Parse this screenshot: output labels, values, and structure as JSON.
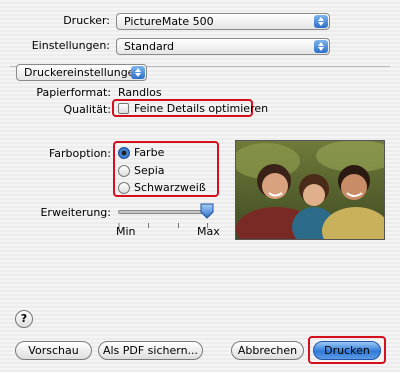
{
  "printer": {
    "label": "Drucker:",
    "value": "PictureMate 500"
  },
  "presets": {
    "label": "Einstellungen:",
    "value": "Standard"
  },
  "panel": {
    "value": "Druckereinstellungen"
  },
  "paper": {
    "label": "Papierformat:",
    "value": "Randlos"
  },
  "quality": {
    "label": "Qualität:",
    "checkbox_label": "Feine Details optimieren",
    "checked": false
  },
  "color_option": {
    "label": "Farboption:",
    "options": [
      {
        "label": "Farbe",
        "selected": true
      },
      {
        "label": "Sepia",
        "selected": false
      },
      {
        "label": "Schwarzweiß",
        "selected": false
      }
    ]
  },
  "expansion": {
    "label": "Erweiterung:",
    "min_label": "Min",
    "max_label": "Max",
    "value_fraction": 1.0
  },
  "buttons": {
    "help": "?",
    "preview": "Vorschau",
    "save_pdf": "Als PDF sichern...",
    "cancel": "Abbrechen",
    "print": "Drucken"
  },
  "colors": {
    "highlight": "#d4101c",
    "accent": "#2f7ad8"
  }
}
